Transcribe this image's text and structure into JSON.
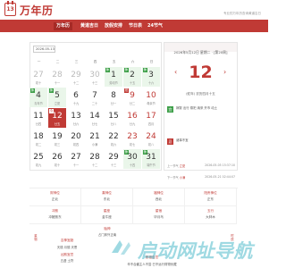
{
  "header": {
    "logo_number": "13",
    "app_name": "万年历",
    "slogan": "专业的万年历查询黄道吉日"
  },
  "nav": {
    "items": [
      {
        "label": "万年历",
        "active": true
      },
      {
        "label": "黄道吉日",
        "active": false
      },
      {
        "label": "放假安排",
        "active": false
      },
      {
        "label": "节日表",
        "active": false
      },
      {
        "label": "24节气",
        "active": false
      }
    ]
  },
  "calendar": {
    "selector_value": "2026-05-13",
    "weekdays": [
      "一",
      "二",
      "三",
      "四",
      "五",
      "六",
      "日"
    ],
    "rows": [
      [
        {
          "d": "27",
          "l": "初十",
          "type": "prev"
        },
        {
          "d": "28",
          "l": "十一",
          "type": "prev"
        },
        {
          "d": "29",
          "l": "十二",
          "type": "prev"
        },
        {
          "d": "30",
          "l": "十三",
          "type": "prev"
        },
        {
          "d": "1",
          "l": "劳动节",
          "type": "hol",
          "tag": "休"
        },
        {
          "d": "2",
          "l": "十五",
          "type": "hol wknd",
          "tag": "休"
        },
        {
          "d": "3",
          "l": "十六",
          "type": "hol wknd",
          "tag": "休"
        }
      ],
      [
        {
          "d": "4",
          "l": "青年节",
          "type": "hol",
          "tag": "休"
        },
        {
          "d": "5",
          "l": "立夏",
          "type": "hol",
          "tag": "休"
        },
        {
          "d": "6",
          "l": "十九",
          "type": ""
        },
        {
          "d": "7",
          "l": "二十",
          "type": ""
        },
        {
          "d": "8",
          "l": "廿一",
          "type": ""
        },
        {
          "d": "9",
          "l": "廿二",
          "type": "wknd",
          "tag": "班",
          "tagred": true
        },
        {
          "d": "10",
          "l": "母亲节",
          "type": "wknd"
        }
      ],
      [
        {
          "d": "11",
          "l": "廿四",
          "type": ""
        },
        {
          "d": "12",
          "l": "廿五",
          "type": "sel",
          "tag": "今"
        },
        {
          "d": "13",
          "l": "廿六",
          "type": ""
        },
        {
          "d": "14",
          "l": "廿七",
          "type": ""
        },
        {
          "d": "15",
          "l": "廿八",
          "type": ""
        },
        {
          "d": "16",
          "l": "廿九",
          "type": "wknd"
        },
        {
          "d": "17",
          "l": "四月",
          "type": "wknd"
        }
      ],
      [
        {
          "d": "18",
          "l": "初二",
          "type": ""
        },
        {
          "d": "19",
          "l": "初三",
          "type": ""
        },
        {
          "d": "20",
          "l": "初四",
          "type": ""
        },
        {
          "d": "21",
          "l": "小满",
          "type": ""
        },
        {
          "d": "22",
          "l": "初六",
          "type": ""
        },
        {
          "d": "23",
          "l": "初七",
          "type": "wknd"
        },
        {
          "d": "24",
          "l": "初八",
          "type": "wknd"
        }
      ],
      [
        {
          "d": "25",
          "l": "初九",
          "type": ""
        },
        {
          "d": "26",
          "l": "初十",
          "type": ""
        },
        {
          "d": "27",
          "l": "十一",
          "type": ""
        },
        {
          "d": "28",
          "l": "十二",
          "type": ""
        },
        {
          "d": "29",
          "l": "十三",
          "type": ""
        },
        {
          "d": "30",
          "l": "十四",
          "type": "hol wknd",
          "tag": "休"
        },
        {
          "d": "31",
          "l": "端午节",
          "type": "hol wknd",
          "tag": "休"
        }
      ]
    ]
  },
  "detail": {
    "date_line": "2026年5月12日 星期二 · [第20周]",
    "prev_arrow": "‹",
    "next_arrow": "›",
    "day": "12",
    "lunar": "(蛇年) 农历四月十五",
    "yi_label": "宜",
    "yi_text": "嫁娶 出行 祭祀 纳采 开市 动土",
    "ji_label": "忌",
    "ji_text": "诸事不宜",
    "prev_term_label": "上一节气",
    "prev_term_name": "立夏",
    "prev_term_time": "2026-05-05 15:37:10",
    "next_term_label": "下一节气",
    "next_term_name": "小满",
    "next_term_time": "2026-05-21 02:44:07"
  },
  "info": {
    "cells": [
      {
        "k": "财神位",
        "v": "正北"
      },
      {
        "k": "喜神位",
        "v": "东北"
      },
      {
        "k": "福神位",
        "v": "西北"
      },
      {
        "k": "阳贵神位",
        "v": "正东"
      },
      {
        "k": "冲煞",
        "v": "冲猪煞东"
      },
      {
        "k": "星座",
        "v": "金牛座"
      },
      {
        "k": "星宿",
        "v": "毕月乌"
      },
      {
        "k": "五行",
        "v": "大林木"
      }
    ],
    "taishen_title": "胎神",
    "taishen_val": "占门床外正南",
    "jishen_title": "吉神宜趋",
    "jishen_val": "天德 月德 天恩",
    "xiongsha_title": "凶煞宜忌",
    "xiongsha_val": "五虚 土符",
    "pengzu_title": "彭祖百忌",
    "pengzu_val": "辛不合酱主人不尝 巳不远行财物伏藏",
    "vertical_left": "星宿",
    "vertical_right": "时辰"
  },
  "watermark": {
    "text": "启动网址导航"
  }
}
